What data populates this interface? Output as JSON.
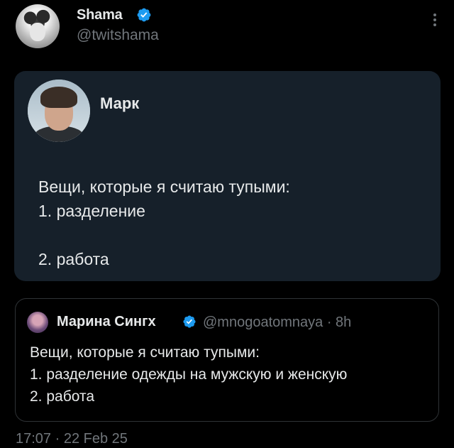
{
  "author": {
    "name": "Shama",
    "handle": "@twitshama"
  },
  "embedded_post": {
    "name": "Марк",
    "lines": [
      "Вещи, которые я считаю тупыми:",
      "1. разделение",
      "",
      "2. работа"
    ]
  },
  "quoted_post": {
    "name": "Марина Сингх",
    "handle_time": "@mnogoatomnaya · 8h",
    "lines": [
      "Вещи, которые я считаю тупыми:",
      "1. разделение одежды на мужскую и женскую",
      "2. работа"
    ]
  },
  "timestamp": "17:07 · 22 Feb 25",
  "colors": {
    "background": "#000000",
    "card": "#16202a",
    "verified": "#1d9bf0",
    "secondary_text": "#71767b"
  },
  "icons": {
    "verified": "verified-badge-icon",
    "more": "more-vertical-icon"
  }
}
